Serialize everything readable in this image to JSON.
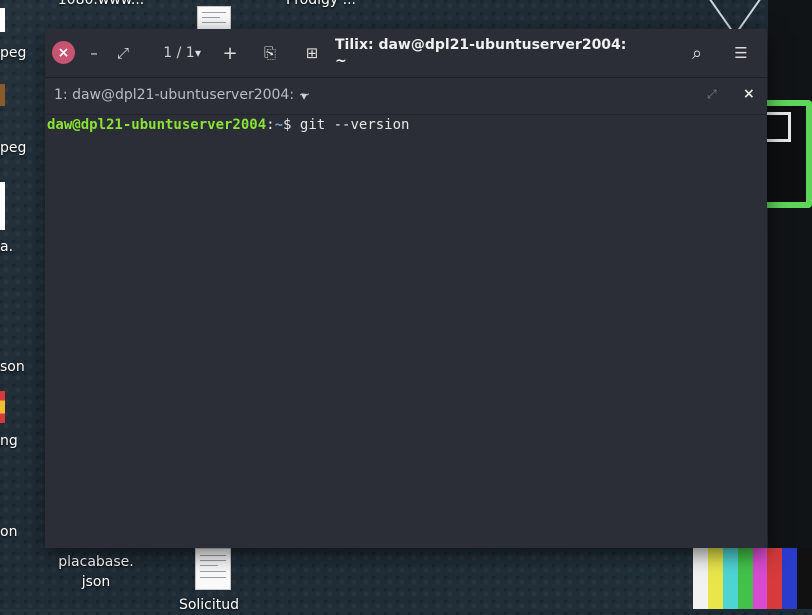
{
  "desktop": {
    "labels": {
      "top_center": "1080.www...",
      "top_right": "Prodigy ...",
      "left_1": "peg",
      "left_2": "peg",
      "left_3": "a.",
      "left_4": "son",
      "left_5": "ng",
      "left_6": "on",
      "placabase_line1": "placabase.",
      "placabase_line2": "json",
      "solicitud": "Solicitud"
    },
    "tv_bar_colors": [
      "#f2f2f2",
      "#e8e64a",
      "#4fd4d4",
      "#43c24a",
      "#d84bd0",
      "#d63a3a",
      "#2b3bcc",
      "#111111"
    ]
  },
  "window": {
    "title": "Tilix: daw@dpl21-ubuntuserver2004: ~",
    "session_count": "1 / 1",
    "accent_close": "#c75470",
    "icons": {
      "close": "×",
      "minimize": "–",
      "maximize": "⤢",
      "session_dropdown": "▾",
      "add_terminal": "+",
      "add_right": "⎘",
      "add_down": "⊞",
      "search": "⌕",
      "menu": "☰"
    },
    "tab": {
      "label": "1: daw@dpl21-ubuntuserver2004: ~",
      "dropdown": "▾",
      "maximize": "⤢",
      "close": "×"
    }
  },
  "terminal": {
    "prompt_user_host": "daw@dpl21-ubuntuserver2004",
    "prompt_sep": ":",
    "prompt_path": "~",
    "prompt_symbol": "$ ",
    "command": "git --version",
    "user_color": "#8ae234",
    "path_color": "#729fcf"
  }
}
